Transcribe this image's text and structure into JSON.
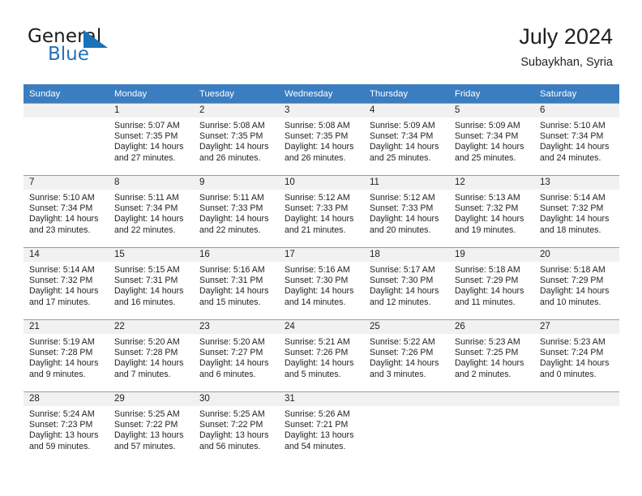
{
  "brand": {
    "word1": "General",
    "word2": "Blue",
    "flag_icon": "blue-triangle-flag-icon",
    "color": "#2272b8"
  },
  "header": {
    "title": "July 2024",
    "subtitle": "Subaykhan, Syria"
  },
  "theme": {
    "header_row_bg": "#3a7dc0",
    "daynum_bg": "#f1f1f1",
    "grid_line": "#9a9a9a",
    "text": "#1f1f1f"
  },
  "weekday_headers": [
    "Sunday",
    "Monday",
    "Tuesday",
    "Wednesday",
    "Thursday",
    "Friday",
    "Saturday"
  ],
  "weeks": [
    [
      {
        "day": "",
        "blank": true,
        "sunrise": "",
        "sunset": "",
        "daylight1": "",
        "daylight2": ""
      },
      {
        "day": "1",
        "sunrise": "Sunrise: 5:07 AM",
        "sunset": "Sunset: 7:35 PM",
        "daylight1": "Daylight: 14 hours",
        "daylight2": "and 27 minutes."
      },
      {
        "day": "2",
        "sunrise": "Sunrise: 5:08 AM",
        "sunset": "Sunset: 7:35 PM",
        "daylight1": "Daylight: 14 hours",
        "daylight2": "and 26 minutes."
      },
      {
        "day": "3",
        "sunrise": "Sunrise: 5:08 AM",
        "sunset": "Sunset: 7:35 PM",
        "daylight1": "Daylight: 14 hours",
        "daylight2": "and 26 minutes."
      },
      {
        "day": "4",
        "sunrise": "Sunrise: 5:09 AM",
        "sunset": "Sunset: 7:34 PM",
        "daylight1": "Daylight: 14 hours",
        "daylight2": "and 25 minutes."
      },
      {
        "day": "5",
        "sunrise": "Sunrise: 5:09 AM",
        "sunset": "Sunset: 7:34 PM",
        "daylight1": "Daylight: 14 hours",
        "daylight2": "and 25 minutes."
      },
      {
        "day": "6",
        "sunrise": "Sunrise: 5:10 AM",
        "sunset": "Sunset: 7:34 PM",
        "daylight1": "Daylight: 14 hours",
        "daylight2": "and 24 minutes."
      }
    ],
    [
      {
        "day": "7",
        "sunrise": "Sunrise: 5:10 AM",
        "sunset": "Sunset: 7:34 PM",
        "daylight1": "Daylight: 14 hours",
        "daylight2": "and 23 minutes."
      },
      {
        "day": "8",
        "sunrise": "Sunrise: 5:11 AM",
        "sunset": "Sunset: 7:34 PM",
        "daylight1": "Daylight: 14 hours",
        "daylight2": "and 22 minutes."
      },
      {
        "day": "9",
        "sunrise": "Sunrise: 5:11 AM",
        "sunset": "Sunset: 7:33 PM",
        "daylight1": "Daylight: 14 hours",
        "daylight2": "and 22 minutes."
      },
      {
        "day": "10",
        "sunrise": "Sunrise: 5:12 AM",
        "sunset": "Sunset: 7:33 PM",
        "daylight1": "Daylight: 14 hours",
        "daylight2": "and 21 minutes."
      },
      {
        "day": "11",
        "sunrise": "Sunrise: 5:12 AM",
        "sunset": "Sunset: 7:33 PM",
        "daylight1": "Daylight: 14 hours",
        "daylight2": "and 20 minutes."
      },
      {
        "day": "12",
        "sunrise": "Sunrise: 5:13 AM",
        "sunset": "Sunset: 7:32 PM",
        "daylight1": "Daylight: 14 hours",
        "daylight2": "and 19 minutes."
      },
      {
        "day": "13",
        "sunrise": "Sunrise: 5:14 AM",
        "sunset": "Sunset: 7:32 PM",
        "daylight1": "Daylight: 14 hours",
        "daylight2": "and 18 minutes."
      }
    ],
    [
      {
        "day": "14",
        "sunrise": "Sunrise: 5:14 AM",
        "sunset": "Sunset: 7:32 PM",
        "daylight1": "Daylight: 14 hours",
        "daylight2": "and 17 minutes."
      },
      {
        "day": "15",
        "sunrise": "Sunrise: 5:15 AM",
        "sunset": "Sunset: 7:31 PM",
        "daylight1": "Daylight: 14 hours",
        "daylight2": "and 16 minutes."
      },
      {
        "day": "16",
        "sunrise": "Sunrise: 5:16 AM",
        "sunset": "Sunset: 7:31 PM",
        "daylight1": "Daylight: 14 hours",
        "daylight2": "and 15 minutes."
      },
      {
        "day": "17",
        "sunrise": "Sunrise: 5:16 AM",
        "sunset": "Sunset: 7:30 PM",
        "daylight1": "Daylight: 14 hours",
        "daylight2": "and 14 minutes."
      },
      {
        "day": "18",
        "sunrise": "Sunrise: 5:17 AM",
        "sunset": "Sunset: 7:30 PM",
        "daylight1": "Daylight: 14 hours",
        "daylight2": "and 12 minutes."
      },
      {
        "day": "19",
        "sunrise": "Sunrise: 5:18 AM",
        "sunset": "Sunset: 7:29 PM",
        "daylight1": "Daylight: 14 hours",
        "daylight2": "and 11 minutes."
      },
      {
        "day": "20",
        "sunrise": "Sunrise: 5:18 AM",
        "sunset": "Sunset: 7:29 PM",
        "daylight1": "Daylight: 14 hours",
        "daylight2": "and 10 minutes."
      }
    ],
    [
      {
        "day": "21",
        "sunrise": "Sunrise: 5:19 AM",
        "sunset": "Sunset: 7:28 PM",
        "daylight1": "Daylight: 14 hours",
        "daylight2": "and 9 minutes."
      },
      {
        "day": "22",
        "sunrise": "Sunrise: 5:20 AM",
        "sunset": "Sunset: 7:28 PM",
        "daylight1": "Daylight: 14 hours",
        "daylight2": "and 7 minutes."
      },
      {
        "day": "23",
        "sunrise": "Sunrise: 5:20 AM",
        "sunset": "Sunset: 7:27 PM",
        "daylight1": "Daylight: 14 hours",
        "daylight2": "and 6 minutes."
      },
      {
        "day": "24",
        "sunrise": "Sunrise: 5:21 AM",
        "sunset": "Sunset: 7:26 PM",
        "daylight1": "Daylight: 14 hours",
        "daylight2": "and 5 minutes."
      },
      {
        "day": "25",
        "sunrise": "Sunrise: 5:22 AM",
        "sunset": "Sunset: 7:26 PM",
        "daylight1": "Daylight: 14 hours",
        "daylight2": "and 3 minutes."
      },
      {
        "day": "26",
        "sunrise": "Sunrise: 5:23 AM",
        "sunset": "Sunset: 7:25 PM",
        "daylight1": "Daylight: 14 hours",
        "daylight2": "and 2 minutes."
      },
      {
        "day": "27",
        "sunrise": "Sunrise: 5:23 AM",
        "sunset": "Sunset: 7:24 PM",
        "daylight1": "Daylight: 14 hours",
        "daylight2": "and 0 minutes."
      }
    ],
    [
      {
        "day": "28",
        "sunrise": "Sunrise: 5:24 AM",
        "sunset": "Sunset: 7:23 PM",
        "daylight1": "Daylight: 13 hours",
        "daylight2": "and 59 minutes."
      },
      {
        "day": "29",
        "sunrise": "Sunrise: 5:25 AM",
        "sunset": "Sunset: 7:22 PM",
        "daylight1": "Daylight: 13 hours",
        "daylight2": "and 57 minutes."
      },
      {
        "day": "30",
        "sunrise": "Sunrise: 5:25 AM",
        "sunset": "Sunset: 7:22 PM",
        "daylight1": "Daylight: 13 hours",
        "daylight2": "and 56 minutes."
      },
      {
        "day": "31",
        "sunrise": "Sunrise: 5:26 AM",
        "sunset": "Sunset: 7:21 PM",
        "daylight1": "Daylight: 13 hours",
        "daylight2": "and 54 minutes."
      },
      {
        "day": "",
        "blank": true,
        "sunrise": "",
        "sunset": "",
        "daylight1": "",
        "daylight2": ""
      },
      {
        "day": "",
        "blank": true,
        "sunrise": "",
        "sunset": "",
        "daylight1": "",
        "daylight2": ""
      },
      {
        "day": "",
        "blank": true,
        "sunrise": "",
        "sunset": "",
        "daylight1": "",
        "daylight2": ""
      }
    ]
  ]
}
